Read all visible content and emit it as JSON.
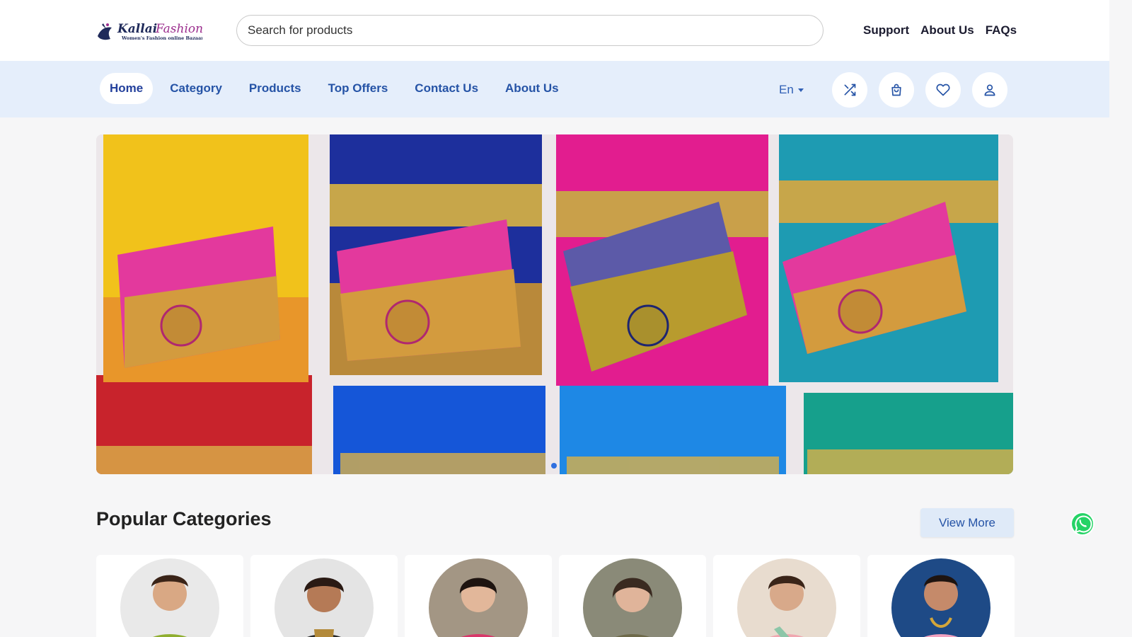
{
  "brand": {
    "name": "Kallai Fashions",
    "tagline": "Women's Fashion online Bazaar"
  },
  "search": {
    "placeholder": "Search for products"
  },
  "top_links": [
    "Support",
    "About Us",
    "FAQs"
  ],
  "nav": {
    "items": [
      "Home",
      "Category",
      "Products",
      "Top Offers",
      "Contact Us",
      "About Us"
    ],
    "active": "Home"
  },
  "language": {
    "selected": "En"
  },
  "header_icons": [
    "shuffle-icon",
    "shopping-bag-icon",
    "heart-icon",
    "user-icon"
  ],
  "hero": {
    "slide_dots": 1,
    "active_dot": 1
  },
  "popular_categories": {
    "title": "Popular Categories",
    "view_more_label": "View More",
    "cards": [
      {
        "dress": "#8fae2f"
      },
      {
        "dress": "#2a2a2a"
      },
      {
        "dress": "#d8386a"
      },
      {
        "dress": "#6e6a4a"
      },
      {
        "dress": "#f0a7b0"
      },
      {
        "dress": "#f2a2c0"
      }
    ]
  },
  "colors": {
    "nav_background": "#e5eefb",
    "nav_text": "#2553a6",
    "accent_dot": "#2f6fe0",
    "whatsapp": "#25d366"
  }
}
